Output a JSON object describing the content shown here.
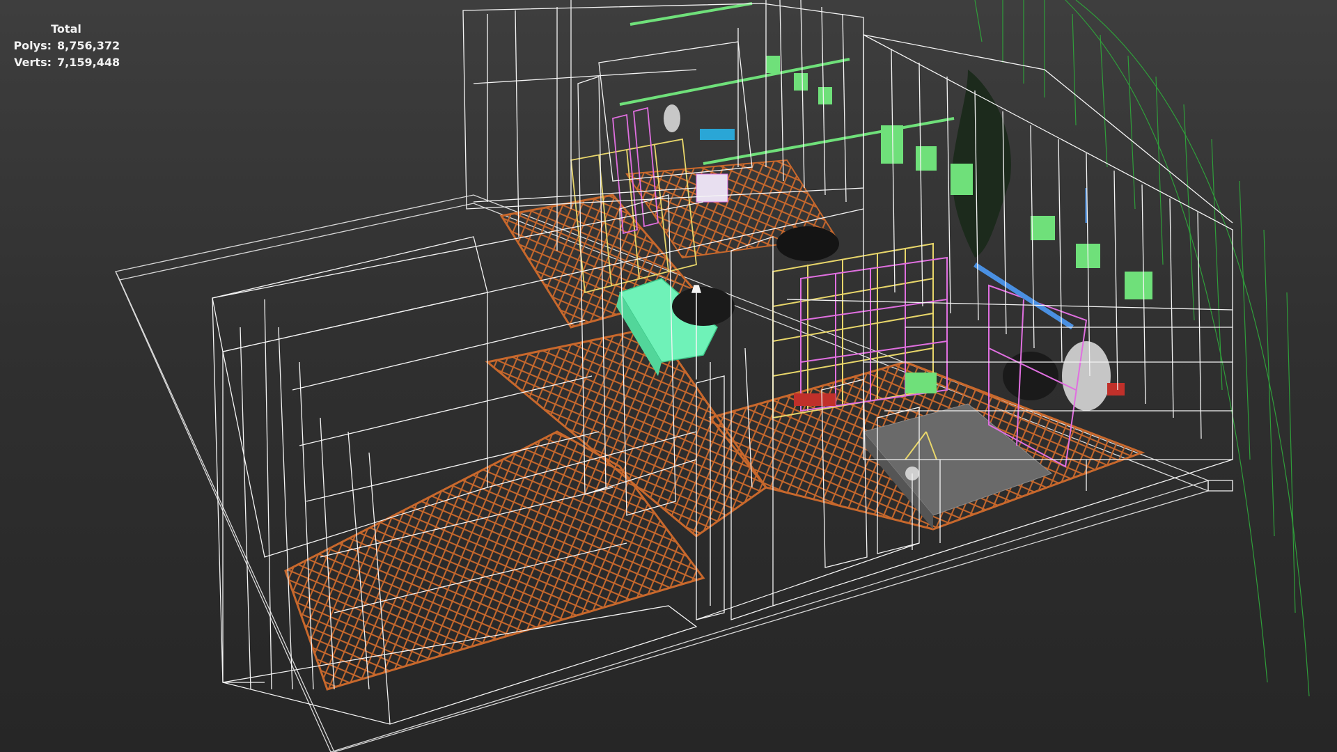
{
  "stats": {
    "title": "Total",
    "rows": [
      {
        "label": "Polys:",
        "value": "8,756,372"
      },
      {
        "label": "Verts:",
        "value": "7,159,448"
      }
    ]
  },
  "colors": {
    "background_top": "#3e3e3e",
    "background_bottom": "#262626",
    "wire_white": "#f4f4f4",
    "floor_wood": "#c8682c",
    "ground_plane": "#d8d8d8",
    "light_green": "#6fe07a",
    "sofa_mint": "#6ff2b8",
    "shelf_pink": "#e06fe0",
    "shelf_yellow": "#e8d66a",
    "camera_green": "#2f9e3a",
    "bed_gray": "#6a6a6a",
    "blue_object": "#4a90e2",
    "red_object": "#c0302a"
  }
}
